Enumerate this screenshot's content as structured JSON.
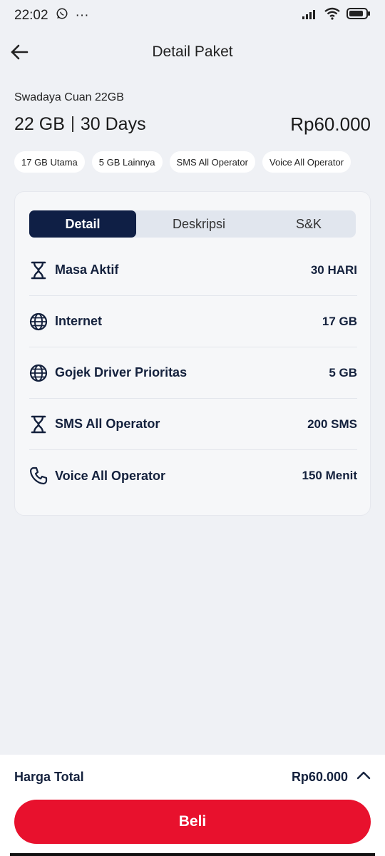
{
  "status_bar": {
    "time": "22:02",
    "more": "···",
    "icons": [
      "whatsapp-icon",
      "signal-icon",
      "wifi-icon",
      "battery-icon"
    ]
  },
  "appbar": {
    "title": "Detail Paket",
    "back_icon": "back-arrow-icon"
  },
  "package": {
    "name": "Swadaya Cuan 22GB",
    "quota": "22 GB",
    "duration": "30 Days",
    "price": "Rp60.000",
    "chips": [
      "17 GB Utama",
      "5 GB Lainnya",
      "SMS All Operator",
      "Voice All Operator"
    ]
  },
  "tabs": [
    {
      "label": "Detail",
      "active": true
    },
    {
      "label": "Deskripsi",
      "active": false
    },
    {
      "label": "S&K",
      "active": false
    }
  ],
  "details": [
    {
      "icon": "hourglass-icon",
      "label": "Masa Aktif",
      "value": "30 HARI"
    },
    {
      "icon": "globe-icon",
      "label": "Internet",
      "value": "17 GB"
    },
    {
      "icon": "globe-icon",
      "label": "Gojek Driver Prioritas",
      "value": "5 GB"
    },
    {
      "icon": "hourglass-icon",
      "label": "SMS All Operator",
      "value": "200 SMS"
    },
    {
      "icon": "phone-icon",
      "label": "Voice All Operator",
      "value": "150 Menit"
    }
  ],
  "footer": {
    "total_label": "Harga Total",
    "total_value": "Rp60.000",
    "buy_label": "Beli"
  },
  "colors": {
    "accent": "#e8112d",
    "navy": "#0f1f45",
    "background": "#eff1f5"
  }
}
